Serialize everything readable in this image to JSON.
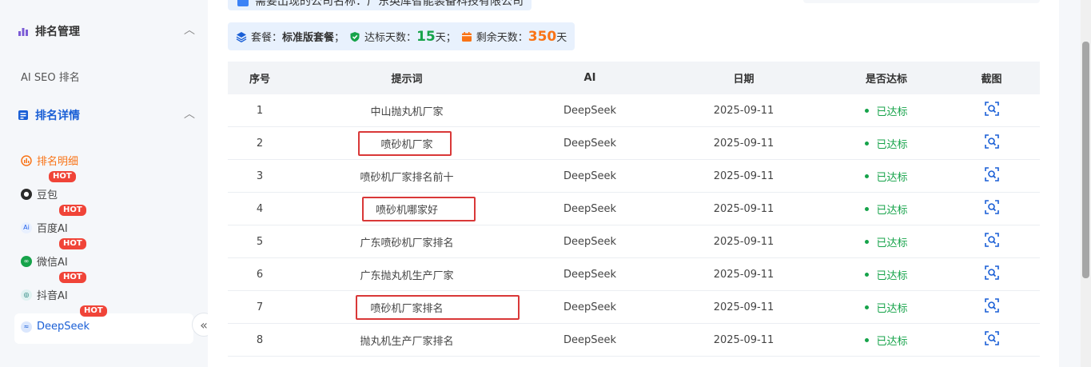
{
  "sidebar": {
    "section1": {
      "label": "排名管理",
      "chevron": "︿"
    },
    "item_seo": "AI SEO 排名",
    "section2": {
      "label": "排名详情",
      "chevron": "︿"
    },
    "detail": "排名明细",
    "hot_label": "HOT",
    "items": [
      {
        "label": "豆包",
        "icon": "doubao-icon"
      },
      {
        "label": "百度AI",
        "icon": "baidu-ai-icon"
      },
      {
        "label": "微信AI",
        "icon": "wechat-ai-icon"
      },
      {
        "label": "抖音AI",
        "icon": "douyin-ai-icon"
      },
      {
        "label": "DeepSeek",
        "icon": "deepseek-icon"
      }
    ],
    "collapse": "«"
  },
  "notice": "需要出现的公司名称：广东英库智能装备科技有限公司",
  "plan": {
    "plan_label": "套餐：",
    "plan_value": "标准版套餐",
    "sep": "；",
    "reach_label": "达标天数：",
    "reach_value": "15",
    "reach_unit": "天；",
    "remain_label": "剩余天数：",
    "remain_value": "350",
    "remain_unit": "天"
  },
  "table": {
    "headers": [
      "序号",
      "提示词",
      "AI",
      "日期",
      "是否达标",
      "截图"
    ],
    "rows": [
      {
        "no": "1",
        "keyword": "中山抛丸机厂家",
        "ai": "DeepSeek",
        "date": "2025-09-11",
        "status": "已达标"
      },
      {
        "no": "2",
        "keyword": "喷砂机厂家",
        "ai": "DeepSeek",
        "date": "2025-09-11",
        "status": "已达标"
      },
      {
        "no": "3",
        "keyword": "喷砂机厂家排名前十",
        "ai": "DeepSeek",
        "date": "2025-09-11",
        "status": "已达标"
      },
      {
        "no": "4",
        "keyword": "喷砂机哪家好",
        "ai": "DeepSeek",
        "date": "2025-09-11",
        "status": "已达标"
      },
      {
        "no": "5",
        "keyword": "广东喷砂机厂家排名",
        "ai": "DeepSeek",
        "date": "2025-09-11",
        "status": "已达标"
      },
      {
        "no": "6",
        "keyword": "广东抛丸机生产厂家",
        "ai": "DeepSeek",
        "date": "2025-09-11",
        "status": "已达标"
      },
      {
        "no": "7",
        "keyword": "喷砂机厂家排名",
        "ai": "DeepSeek",
        "date": "2025-09-11",
        "status": "已达标"
      },
      {
        "no": "8",
        "keyword": "抛丸机生产厂家排名",
        "ai": "DeepSeek",
        "date": "2025-09-11",
        "status": "已达标"
      }
    ]
  },
  "colors": {
    "accent": "#1a5fd6",
    "success": "#16a34a",
    "warning": "#f97316",
    "hot": "#f04438",
    "highlight": "#d93838"
  }
}
